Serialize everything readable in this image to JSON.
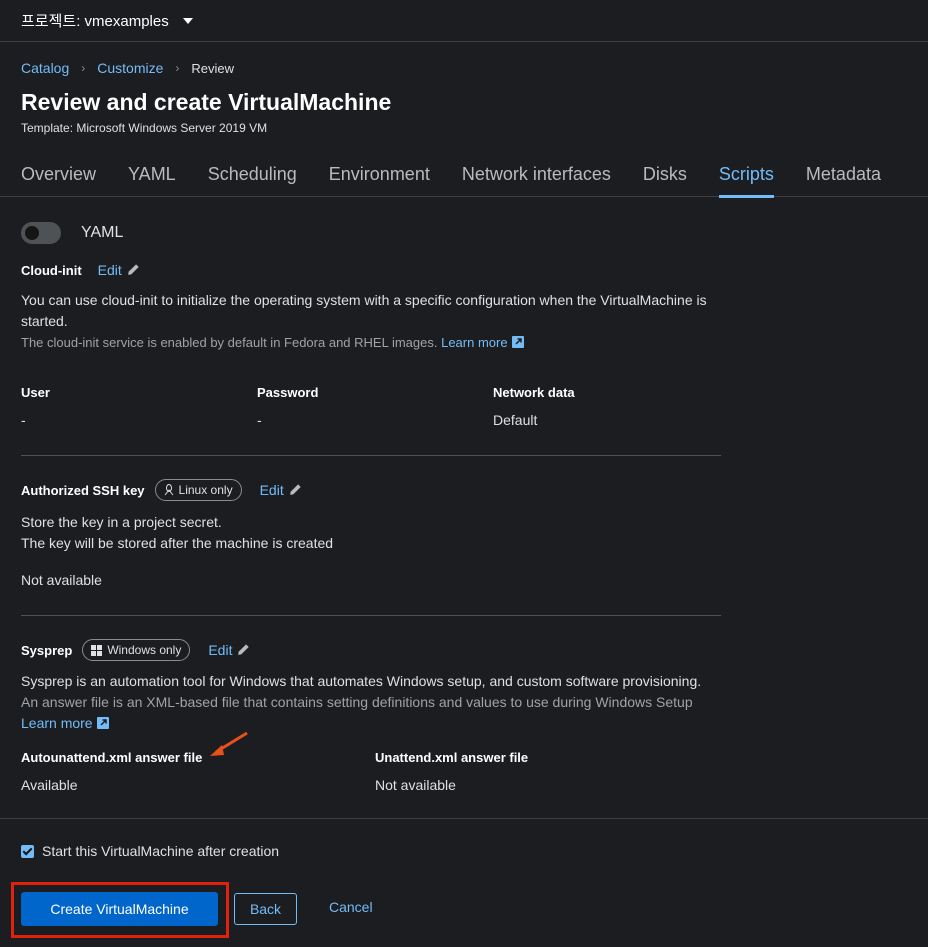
{
  "project": {
    "label": "프로젝트: vmexamples"
  },
  "breadcrumb": {
    "catalog": "Catalog",
    "customize": "Customize",
    "review": "Review"
  },
  "page": {
    "title": "Review and create VirtualMachine",
    "subtitle": "Template: Microsoft Windows Server 2019 VM"
  },
  "tabs": [
    {
      "label": "Overview"
    },
    {
      "label": "YAML"
    },
    {
      "label": "Scheduling"
    },
    {
      "label": "Environment"
    },
    {
      "label": "Network interfaces"
    },
    {
      "label": "Disks"
    },
    {
      "label": "Scripts"
    },
    {
      "label": "Metadata"
    }
  ],
  "active_tab": "Scripts",
  "yaml_toggle": {
    "label": "YAML",
    "on": false
  },
  "cloud_init": {
    "title": "Cloud-init",
    "edit": "Edit",
    "description": "You can use cloud-init to initialize the operating system with a specific configuration when the VirtualMachine is started.",
    "note": "The cloud-init service is enabled by default in Fedora and RHEL images.",
    "learn_more": "Learn more",
    "fields": {
      "user_label": "User",
      "user_value": "-",
      "password_label": "Password",
      "password_value": "-",
      "network_label": "Network data",
      "network_value": "Default"
    }
  },
  "ssh": {
    "title": "Authorized SSH key",
    "badge": "Linux only",
    "edit": "Edit",
    "line1": "Store the key in a project secret.",
    "line2": "The key will be stored after the machine is created",
    "status": "Not available"
  },
  "sysprep": {
    "title": "Sysprep",
    "badge": "Windows only",
    "edit": "Edit",
    "description": "Sysprep is an automation tool for Windows that automates Windows setup, and custom software provisioning.",
    "note": "An answer file is an XML-based file that contains setting definitions and values to use during Windows Setup",
    "learn_more": "Learn more",
    "autounattend_label": "Autounattend.xml answer file",
    "autounattend_value": "Available",
    "unattend_label": "Unattend.xml answer file",
    "unattend_value": "Not available"
  },
  "footer": {
    "start_after_creation": "Start this VirtualMachine after creation",
    "start_checked": true,
    "create_button": "Create VirtualMachine",
    "back_button": "Back",
    "cancel_button": "Cancel"
  },
  "colors": {
    "accent": "#73bcf7",
    "primary": "#0066cc",
    "highlight": "#e0210d",
    "background": "#1b1d21"
  }
}
